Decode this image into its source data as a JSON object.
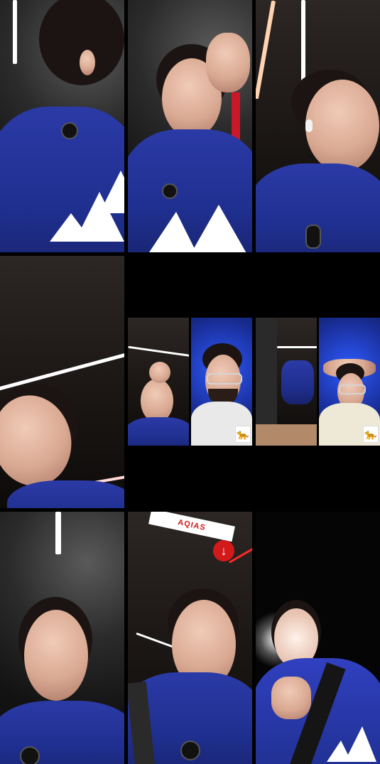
{
  "grid": {
    "tiles": [
      {
        "id": "r1c1",
        "scene": "woman-back-blue-hoodie"
      },
      {
        "id": "r1c2",
        "scene": "woman-selfie-touching-forehead"
      },
      {
        "id": "r1c3",
        "scene": "woman-looking-right-earbud"
      },
      {
        "id": "r2c1",
        "scene": "woman-tilted-ceiling-lights"
      },
      {
        "id": "r2c2",
        "scene": "split-call-woman-and-man-smiling"
      },
      {
        "id": "r2c3",
        "scene": "split-call-gym-machine-and-man-hands-on-head"
      },
      {
        "id": "r3c1",
        "scene": "woman-talking-gym"
      },
      {
        "id": "r3c2",
        "scene": "woman-smiling-backpack-strap"
      },
      {
        "id": "r3c3",
        "scene": "woman-flash-bright-hoodie"
      }
    ]
  },
  "overlays": {
    "badge_icon": "cheetah-emoji-badge",
    "sign_text": "AQIAS",
    "sign_arrow": "arrow-down-red"
  },
  "colors": {
    "hoodie_blue": "#2b3aa6",
    "accent_red": "#d31a1a",
    "background": "#000000"
  }
}
